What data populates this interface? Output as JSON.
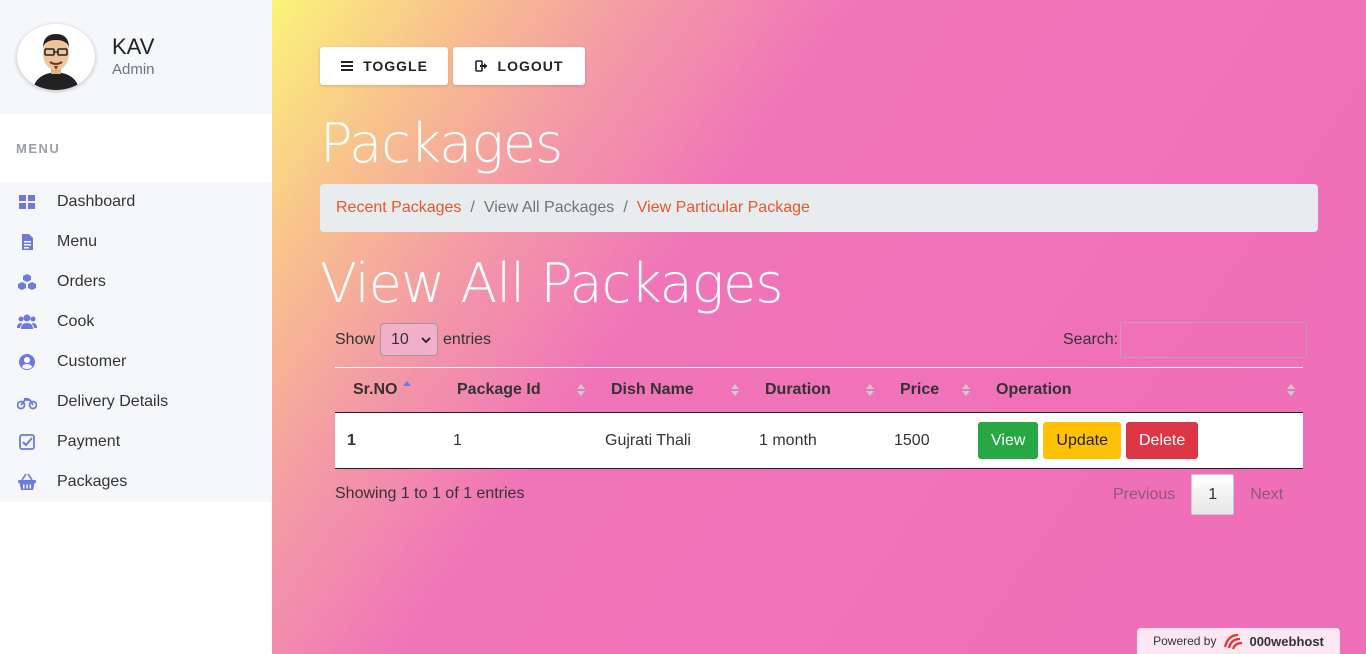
{
  "profile": {
    "name": "KAV",
    "role": "Admin"
  },
  "sidebar": {
    "menu_header": "MENU",
    "items": [
      {
        "label": "Dashboard",
        "icon": "dashboard-icon"
      },
      {
        "label": "Menu",
        "icon": "file-icon"
      },
      {
        "label": "Orders",
        "icon": "cubes-icon"
      },
      {
        "label": "Cook",
        "icon": "users-icon"
      },
      {
        "label": "Customer",
        "icon": "user-circle-icon"
      },
      {
        "label": "Delivery Details",
        "icon": "motorcycle-icon"
      },
      {
        "label": "Payment",
        "icon": "check-square-icon"
      },
      {
        "label": "Packages",
        "icon": "basket-icon"
      }
    ]
  },
  "toolbar": {
    "toggle_label": "TOGGLE",
    "logout_label": "LOGOUT"
  },
  "page": {
    "title": "Packages",
    "section_title": "View All Packages"
  },
  "breadcrumb": {
    "item1": "Recent Packages",
    "item2": "View All Packages",
    "item3": "View Particular Package"
  },
  "table_controls": {
    "show_label": "Show",
    "entries_value": "10",
    "entries_label": "entries",
    "search_label": "Search:"
  },
  "table": {
    "columns": [
      "Sr.NO",
      "Package Id",
      "Dish Name",
      "Duration",
      "Price",
      "Operation"
    ],
    "rows": [
      {
        "sr": "1",
        "package_id": "1",
        "dish": "Gujrati Thali",
        "duration": "1 month",
        "price": "1500"
      }
    ],
    "actions": {
      "view": "View",
      "update": "Update",
      "delete": "Delete"
    }
  },
  "footer": {
    "info": "Showing 1 to 1 of 1 entries",
    "previous": "Previous",
    "page": "1",
    "next": "Next"
  },
  "powered": {
    "label": "Powered by",
    "brand": "000webhost"
  },
  "colors": {
    "accent": "#e8562a",
    "view": "#28a745",
    "update": "#ffc107",
    "delete": "#dc3545",
    "icon": "#6c7ae0"
  }
}
